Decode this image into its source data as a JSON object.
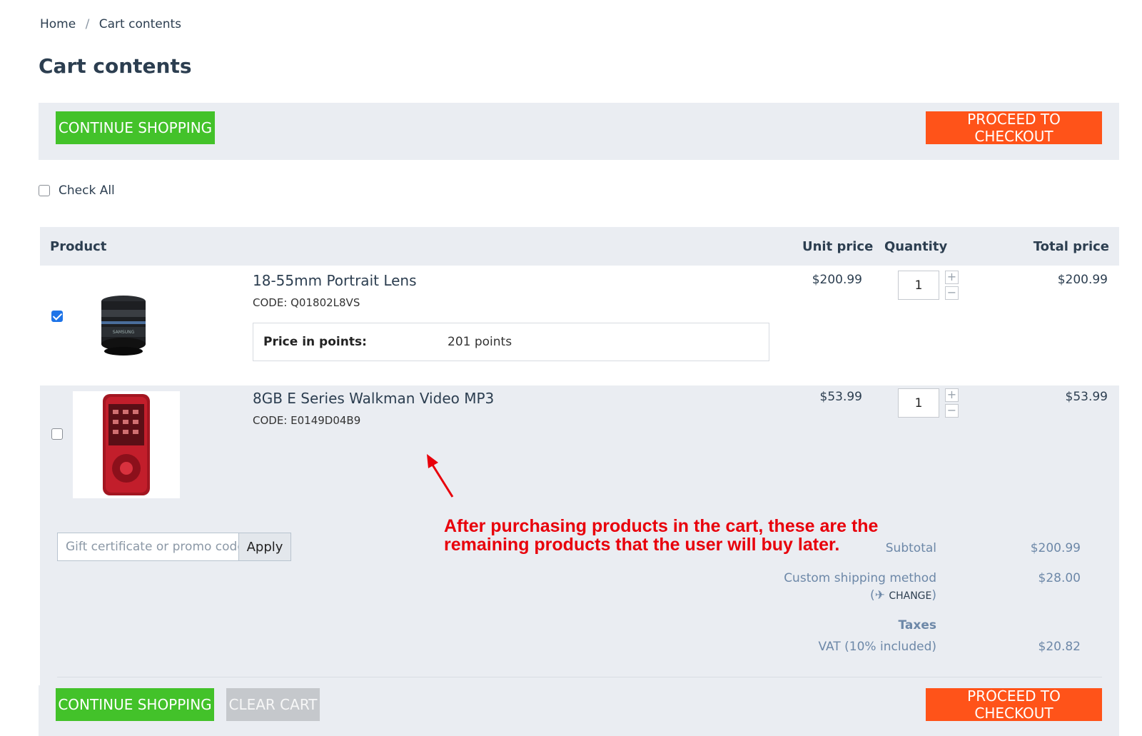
{
  "breadcrumb": {
    "home": "Home",
    "separator": "/",
    "current": "Cart contents"
  },
  "page_title": "Cart contents",
  "buttons": {
    "continue_shopping": "CONTINUE SHOPPING",
    "proceed_to_checkout": "PROCEED TO CHECKOUT",
    "clear_cart": "CLEAR CART"
  },
  "check_all_label": "Check All",
  "table": {
    "headers": {
      "product": "Product",
      "unit_price": "Unit price",
      "quantity": "Quantity",
      "total_price": "Total price"
    },
    "rows": [
      {
        "name": "18-55mm Portrait Lens",
        "code": "CODE: Q01802L8VS",
        "points_label": "Price in points:",
        "points_value": "201 points",
        "unit_price": "$200.99",
        "quantity": "1",
        "total_price": "$200.99",
        "checked": true,
        "icon": "camera-lens-icon"
      },
      {
        "name": "8GB E Series Walkman Video MP3",
        "code": "CODE: E0149D04B9",
        "unit_price": "$53.99",
        "quantity": "1",
        "total_price": "$53.99",
        "checked": false,
        "icon": "mp3-player-icon"
      }
    ]
  },
  "stepper": {
    "plus": "+",
    "minus": "−"
  },
  "promo": {
    "placeholder": "Gift certificate or promo code",
    "apply": "Apply"
  },
  "summary": {
    "subtotal_label": "Subtotal",
    "subtotal_value": "$200.99",
    "shipping_label": "Custom shipping method",
    "shipping_change": "CHANGE",
    "shipping_value": "$28.00",
    "taxes_label": "Taxes",
    "vat_label": "VAT (10% included)",
    "vat_value": "$20.82"
  },
  "annotation": {
    "line1": "After purchasing products in the cart, these are the",
    "line2": "remaining products that the user will buy later."
  },
  "colors": {
    "green": "#43c22a",
    "orange": "#ff5319",
    "gray": "#c5c8cc",
    "annotation_red": "#e8000b",
    "panel_bg": "#eaedf2"
  }
}
